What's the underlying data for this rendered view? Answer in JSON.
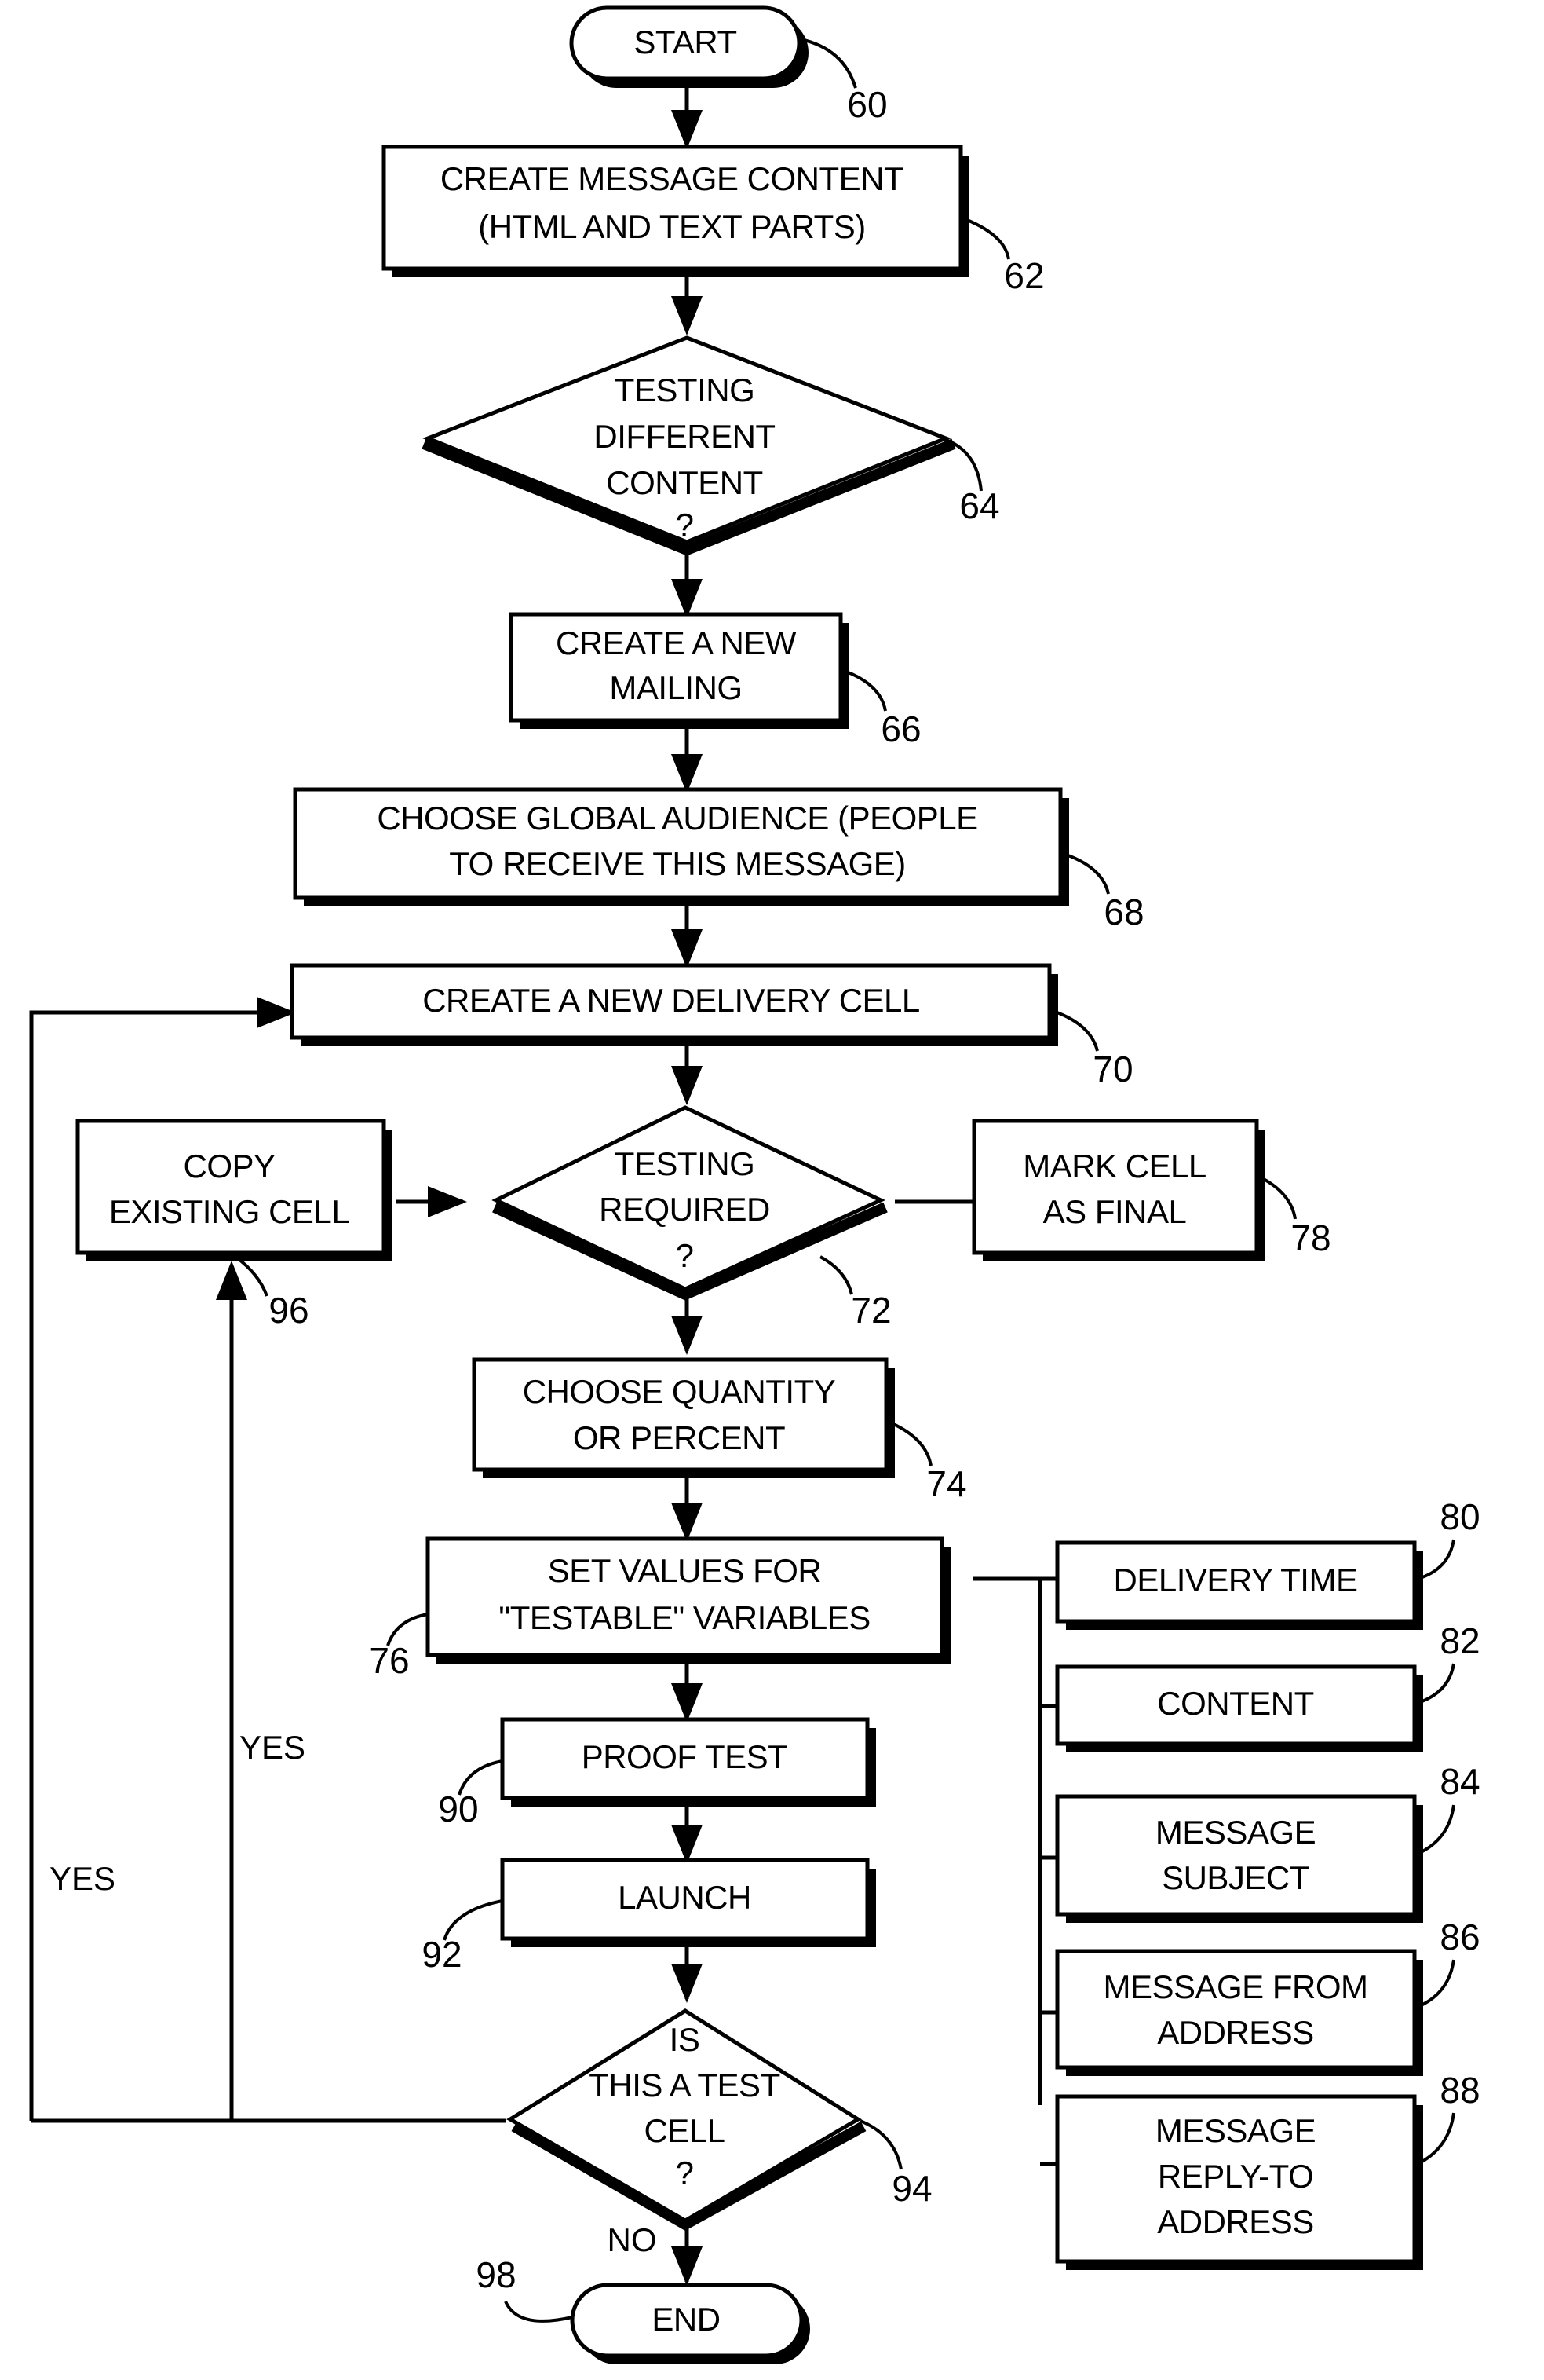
{
  "diagram": {
    "type": "flowchart",
    "title": "Email mailing delivery-cell testing process",
    "nodes": [
      {
        "id": "start",
        "ref": "60",
        "shape": "terminator",
        "text": [
          "START"
        ]
      },
      {
        "id": "create_msg",
        "ref": "62",
        "shape": "process",
        "text": [
          "CREATE MESSAGE CONTENT",
          "(HTML AND TEXT PARTS)"
        ]
      },
      {
        "id": "test_diff",
        "ref": "64",
        "shape": "decision",
        "text": [
          "TESTING",
          "DIFFERENT",
          "CONTENT",
          "?"
        ]
      },
      {
        "id": "new_mailing",
        "ref": "66",
        "shape": "process",
        "text": [
          "CREATE A NEW",
          "MAILING"
        ]
      },
      {
        "id": "audience",
        "ref": "68",
        "shape": "process",
        "text": [
          "CHOOSE GLOBAL AUDIENCE (PEOPLE",
          "TO RECEIVE THIS MESSAGE)"
        ]
      },
      {
        "id": "new_cell",
        "ref": "70",
        "shape": "process",
        "text": [
          "CREATE A NEW DELIVERY CELL"
        ]
      },
      {
        "id": "test_req",
        "ref": "72",
        "shape": "decision",
        "text": [
          "TESTING",
          "REQUIRED",
          "?"
        ]
      },
      {
        "id": "copy_cell",
        "ref": "96",
        "shape": "process",
        "text": [
          "COPY",
          "EXISTING CELL"
        ]
      },
      {
        "id": "mark_final",
        "ref": "78",
        "shape": "process",
        "text": [
          "MARK CELL",
          "AS FINAL"
        ]
      },
      {
        "id": "quantity",
        "ref": "74",
        "shape": "process",
        "text": [
          "CHOOSE QUANTITY",
          "OR PERCENT"
        ]
      },
      {
        "id": "set_values",
        "ref": "76",
        "shape": "process",
        "text": [
          "SET VALUES FOR",
          "\"TESTABLE\" VARIABLES"
        ]
      },
      {
        "id": "proof_test",
        "ref": "90",
        "shape": "process",
        "text": [
          "PROOF TEST"
        ]
      },
      {
        "id": "launch",
        "ref": "92",
        "shape": "process",
        "text": [
          "LAUNCH"
        ]
      },
      {
        "id": "is_test",
        "ref": "94",
        "shape": "decision",
        "text": [
          "IS",
          "THIS A TEST",
          "CELL",
          "?"
        ]
      },
      {
        "id": "end",
        "ref": "98",
        "shape": "terminator",
        "text": [
          "END"
        ]
      },
      {
        "id": "delivery_time",
        "ref": "80",
        "shape": "process",
        "text": [
          "DELIVERY TIME"
        ]
      },
      {
        "id": "content",
        "ref": "82",
        "shape": "process",
        "text": [
          "CONTENT"
        ]
      },
      {
        "id": "msg_subject",
        "ref": "84",
        "shape": "process",
        "text": [
          "MESSAGE",
          "SUBJECT"
        ]
      },
      {
        "id": "msg_from",
        "ref": "86",
        "shape": "process",
        "text": [
          "MESSAGE FROM",
          "ADDRESS"
        ]
      },
      {
        "id": "msg_replyto",
        "ref": "88",
        "shape": "process",
        "text": [
          "MESSAGE",
          "REPLY-TO",
          "ADDRESS"
        ]
      }
    ],
    "edge_labels": [
      {
        "id": "yes_outer",
        "text": "YES"
      },
      {
        "id": "yes_inner",
        "text": "YES"
      },
      {
        "id": "no_end",
        "text": "NO"
      }
    ],
    "reference_numerals": [
      "60",
      "62",
      "64",
      "66",
      "68",
      "70",
      "72",
      "74",
      "76",
      "78",
      "80",
      "82",
      "84",
      "86",
      "88",
      "90",
      "92",
      "94",
      "96",
      "98"
    ],
    "colors": {
      "line": "#000000",
      "fill": "#ffffff",
      "text": "#000000"
    }
  }
}
